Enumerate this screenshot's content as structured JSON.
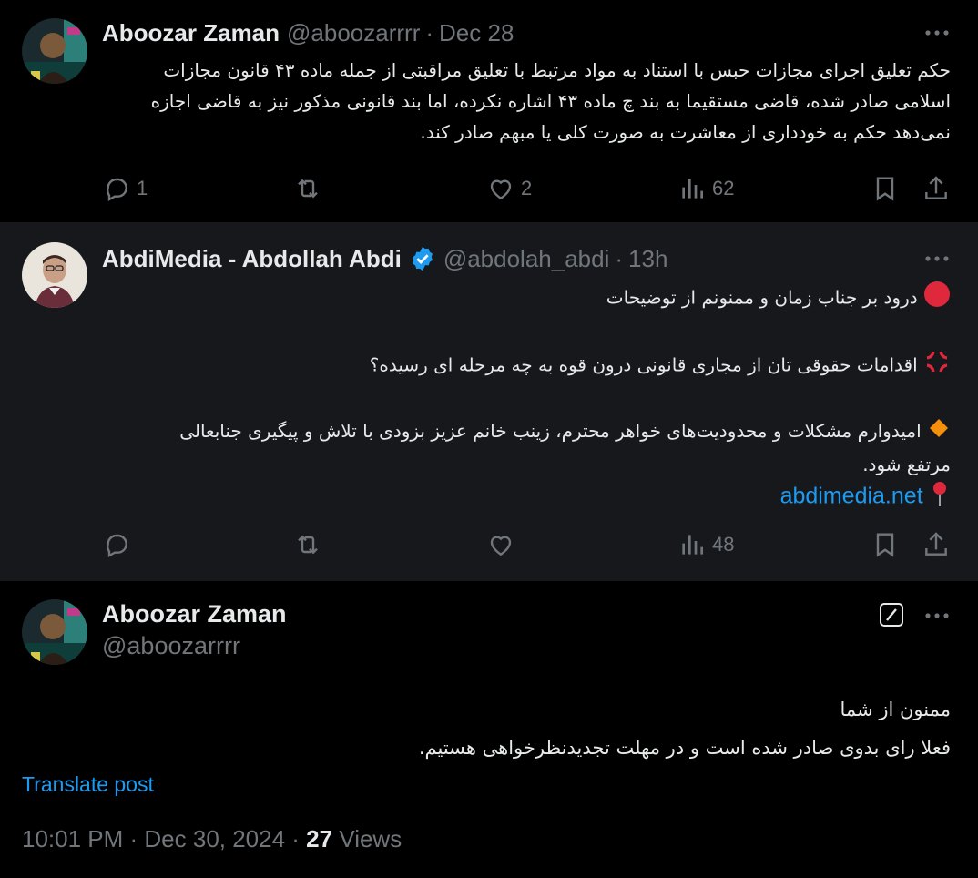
{
  "tweets": [
    {
      "name": "Aboozar Zaman",
      "handle": "@aboozarrrr",
      "time": "Dec 28",
      "text_lines": [
        "حکم تعلیق اجرای مجازات حبس با استناد به مواد مرتبط با تعلیق مراقبتی از جمله ماده ۴۳ قانون مجازات",
        "اسلامی صادر شده، قاضی مستقیما به بند چ ماده ۴۳ اشاره نکرده، اما بند قانونی مذکور نیز به قاضی اجازه",
        "نمی‌دهد حکم به خودداری از معاشرت به صورت کلی یا مبهم صادر کند."
      ],
      "replies": "1",
      "retweets": "",
      "likes": "2",
      "views": "62"
    },
    {
      "name": "AbdiMedia - Abdollah Abdi",
      "handle": "@abdolah_abdi",
      "time": "13h",
      "verified": true,
      "line1": "درود بر جناب زمان و ممنونم از توضیحات",
      "line2": "اقدامات حقوقی تان از مجاری قانونی درون قوه به چه مرحله ای رسیده؟",
      "line3a": "امیدوارم مشکلات و محدودیت‌های خواهر محترم، زینب خانم عزیز بزودی با تلاش و پیگیری جنابعالی",
      "line3b": "مرتفع شود.",
      "link": "abdimedia.net",
      "replies": "",
      "retweets": "",
      "likes": "",
      "views": "48"
    },
    {
      "name": "Aboozar Zaman",
      "handle": "@aboozarrrr",
      "text_lines": [
        "ممنون از شما",
        "فعلا رای بدوی صادر شده است و در مهلت تجدیدنظرخواهی هستیم."
      ],
      "translate": "Translate post",
      "timestamp": "10:01 PM · Dec 30, 2024 · ",
      "views_count": "27",
      "views_label": " Views"
    }
  ],
  "colors": {
    "background": "#000000",
    "highlight_bg": "#16181c",
    "text": "#e7e9ea",
    "muted": "#71767b",
    "accent": "#1d9bf0"
  },
  "icons": [
    "reply-icon",
    "retweet-icon",
    "like-icon",
    "views-icon",
    "bookmark-icon",
    "share-icon",
    "more-icon",
    "verified-icon",
    "edit-icon"
  ]
}
